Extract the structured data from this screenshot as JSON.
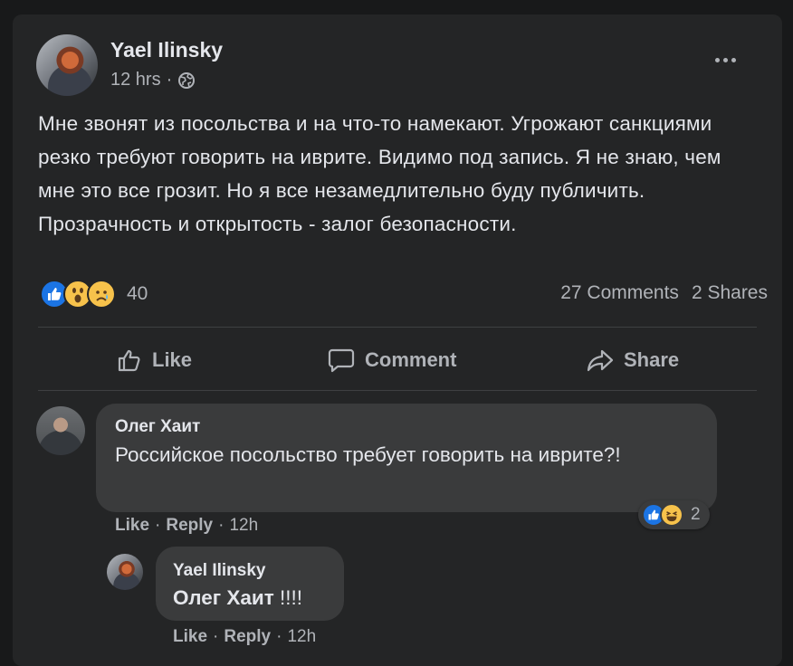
{
  "post": {
    "author": "Yael Ilinsky",
    "time": "12 hrs",
    "separator": "·",
    "body": "Мне звонят из посольства и на что-то намекают. Угрожают санкциями  резко требуют говорить на иврите. Видимо под запись. Я не знаю, чем мне это все грозит. Но я все незамедлительно буду публичить. Прозрачность и открытость - залог безопасности.",
    "reactions": [
      "like-icon",
      "wow-icon",
      "sad-icon"
    ],
    "reaction_count": "40",
    "comments_count": "27 Comments",
    "shares_count": "2 Shares"
  },
  "actions": {
    "like": "Like",
    "comment": "Comment",
    "share": "Share"
  },
  "comments": [
    {
      "author": "Олег Хаит",
      "text": "Российское посольство требует говорить на иврите?!",
      "reactions": [
        "like-icon",
        "haha-icon"
      ],
      "reaction_count": "2",
      "like": "Like",
      "reply": "Reply",
      "time": "12h"
    },
    {
      "author": "Yael Ilinsky",
      "mention": "Олег Хаит",
      "text": " !!!!",
      "like": "Like",
      "reply": "Reply",
      "time": "12h"
    }
  ],
  "colors": {
    "background": "#18191a",
    "card": "#242526",
    "bubble": "#3a3b3c",
    "primary_text": "#e4e6eb",
    "secondary_text": "#b0b3b8",
    "like_blue": "#1b74e4",
    "emoji_yellow": "#f7c24b"
  }
}
